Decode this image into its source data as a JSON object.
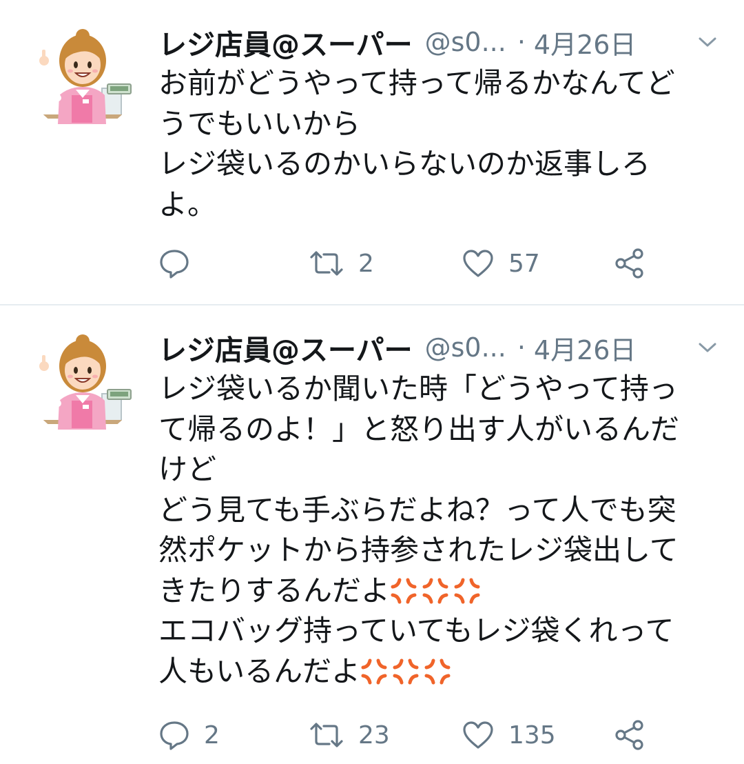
{
  "tweets": [
    {
      "display_name": "レジ店員@スーパー",
      "handle": "@s0...",
      "separator": "·",
      "date": "4月26日",
      "lines": [
        "お前がどうやって持って帰るかなんてど",
        "うでもいいから",
        "レジ袋いるのかいらないのか返事しろ",
        "よ。"
      ],
      "reply_count": "",
      "retweet_count": "2",
      "like_count": "57"
    },
    {
      "display_name": "レジ店員@スーパー",
      "handle": "@s0...",
      "separator": "·",
      "date": "4月26日",
      "lines": [
        "レジ袋いるか聞いた時「どうやって持っ",
        "て帰るのよ！」と怒り出す人がいるんだ",
        "けど",
        "どう見ても手ぶらだよね？って人でも突",
        "然ポケットから持参されたレジ袋出して",
        "きたりするんだよ",
        "エコバッグ持っていてもレジ袋くれって",
        "人もいるんだよ"
      ],
      "reply_count": "2",
      "retweet_count": "23",
      "like_count": "135"
    }
  ],
  "icons": {
    "avatar": "cashier-avatar",
    "caret": "chevron-down-icon",
    "reply": "reply-icon",
    "retweet": "retweet-icon",
    "like": "heart-icon",
    "share": "share-icon",
    "emoji": "anger-symbol-emoji"
  },
  "colors": {
    "text": "#14171a",
    "secondary": "#657786",
    "divider": "#e6ecf0",
    "anger_emoji": "#f0642a"
  }
}
